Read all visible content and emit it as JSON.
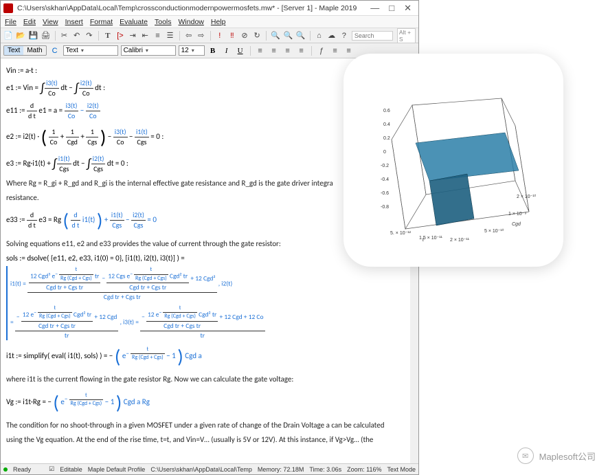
{
  "window": {
    "title": "C:\\Users\\skhan\\AppData\\Local\\Temp\\crossconductionmodernpowermosfets.mw* - [Server 1] - Maple 2019",
    "min": "—",
    "max": "□",
    "close": "✕"
  },
  "menus": [
    "File",
    "Edit",
    "View",
    "Insert",
    "Format",
    "Evaluate",
    "Tools",
    "Window",
    "Help"
  ],
  "toolbar1": {
    "search_placeholder": "Search",
    "right_box": "Alt + S"
  },
  "formatbar": {
    "mode_text": "Text",
    "mode_math": "Math",
    "refresh": "C",
    "style": "Text",
    "font": "Calibri",
    "size": "12",
    "bold": "B",
    "italic": "I",
    "underline": "U"
  },
  "content": {
    "vin": "Vin := a·t :",
    "e1_lhs": "e1 := Vin =",
    "i3co_n": "i3(t)",
    "i3co_d": "Co",
    "i2co_n": "i2(t)",
    "i2co_d": "Co",
    "dt": " dt ",
    "e11_lhs": "e11 := ",
    "ddt_n": "d",
    "ddt_d": "d t",
    "e11_mid": " e1 = a = ",
    "minus": " − ",
    "e2_lhs": "e2 := i2(t) · ",
    "oneCo_n": "1",
    "oneCo_d": "Co",
    "oneCgd_n": "1",
    "oneCgd_d": "Cgd",
    "oneCgs_n": "1",
    "oneCgs_d": "Cgs",
    "i1cgs_n": "i1(t)",
    "i1cgs_d": "Cgs",
    "eq0": " = 0 :",
    "eq0b": " = 0",
    "e3_lhs": "e3 := Rg·i1(t) + ",
    "i2cgs_n": "i2(t)",
    "i2cgs_d": "Cgs",
    "where": "Where Rg = R_gi + R_gd and R_gi is the internal effective gate resistance and R_gd is the gate driver integra",
    "resistance": "resistance.",
    "e33_lhs": "e33 := ",
    "e33_mid": " e3 = Rg ",
    "di1": "i1(t)",
    "plus": " + ",
    "solving": "Solving equations e11, e2 and e33 provides the value of current through the gate resistor:",
    "sols": "sols := dsolve( {e11, e2, e33, i1(0) = 0}, [i1(t), i2(t), i3(t)] ) =",
    "i1t_lhs": "i1(t) = ",
    "expfrac_n": "t",
    "expfrac_d": "Rg (Cgd + Cgs)",
    "twelveCgd3": "12 Cgd³ e",
    "tr": " tr",
    "cgdtr": "Cgd tr + Cgs tr",
    "twelveCgs": "12 Cgs e",
    "cgd2tr": "Cgd² tr",
    "plus12cgd2": " + 12 Cgd²",
    "i2t": ", i2(t)",
    "eqline3_l": "= ",
    "twelveE": "12 e",
    "plus12cgd": " + 12 Cgd",
    "i3t": ", i3(t) = ",
    "plus12cgdco": " + 12 Cgd + 12 Co",
    "tr_only": "tr",
    "i1t_simp": "i1t := simplify( eval( i1(t), sols) ) = − ",
    "exp_e": "e",
    "minus1": " − 1",
    "cgda": " Cgd a",
    "where2": "where i1t is the current flowing in the gate resistor Rg. Now we can calculate the gate voltage:",
    "vg": "Vg := i1t·Rg = − ",
    "cgdaRg": " Cgd a Rg",
    "cond1": "The condition for no shoot-through in a given MOSFET under a given rate of change of the Drain Voltage a can be calculated",
    "cond2": "using the Vg equation. At the end of the rise time, t=t, and Vin=V… (usually is 5V or 12V). At this instance, if Vg>Vg… (the"
  },
  "status": {
    "ready": "Ready",
    "editable": "Editable",
    "profile": "Maple Default Profile",
    "path": "C:\\Users\\skhan\\AppData\\Local\\Temp",
    "memory": "Memory: 72.18M",
    "time": "Time: 3.06s",
    "zoom": "Zoom: 116%",
    "mode": "Text Mode"
  },
  "plot": {
    "ylabel_vals": [
      "0.6",
      "0.4",
      "0.2",
      "0",
      "-0.2",
      "-0.4",
      "-0.6",
      "-0.8"
    ],
    "x_left": "5. × 10⁻¹²",
    "x_left2": "1.5 × 10⁻¹¹",
    "x_left3": "2 × 10⁻¹¹",
    "x_right": "2 × 10⁻¹⁰",
    "x_right2": "1 × 10⁻⁹",
    "x_right3": "5 × 10⁻¹⁰",
    "axis_l": "t",
    "axis_r": "Cgd"
  },
  "attribution": "Maplesoft公司",
  "chart_data": {
    "type": "surface3d",
    "title": "",
    "x_axis": {
      "label": "t",
      "range_hint": [
        "5e-12",
        "2e-11"
      ]
    },
    "y_axis": {
      "label": "Cgd",
      "range_hint": [
        "2e-10",
        "1e-9"
      ]
    },
    "z_axis": {
      "label": "",
      "range": [
        -0.8,
        0.6
      ],
      "ticks": [
        0.6,
        0.4,
        0.2,
        0,
        -0.2,
        -0.4,
        -0.6,
        -0.8
      ]
    },
    "surfaces": 2,
    "color": "#2b7fa8"
  }
}
